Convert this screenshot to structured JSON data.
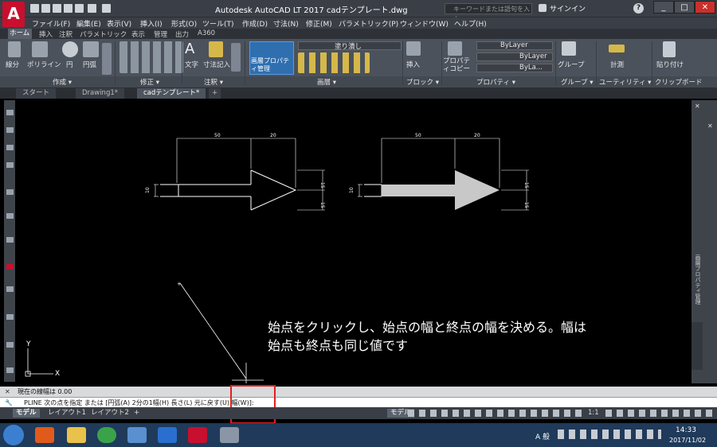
{
  "app": {
    "logo_letter": "A",
    "title": "Autodesk AutoCAD LT 2017    cadテンプレート.dwg",
    "search_placeholder": "キーワードまたは語句を入力",
    "signin": "サインイン",
    "window_buttons": [
      "_",
      "□",
      "✕"
    ]
  },
  "menu": [
    "ファイル(F)",
    "編集(E)",
    "表示(V)",
    "挿入(I)",
    "形式(O)",
    "ツール(T)",
    "作成(D)",
    "寸法(N)",
    "修正(M)",
    "パラメトリック(P)",
    "ウィンドウ(W)",
    "ヘルプ(H)"
  ],
  "ribbon_tabs": [
    "ホーム",
    "挿入",
    "注釈",
    "パラメトリック",
    "表示",
    "管理",
    "出力",
    "A360"
  ],
  "ribbon": {
    "draw": {
      "line": "線分",
      "polyline": "ポリライン",
      "circle": "円",
      "arc": "円弧",
      "panel": "作成 ▾"
    },
    "modify": {
      "panel": "修正 ▾"
    },
    "annotation": {
      "text": "文字",
      "dimension": "寸法記入",
      "panel": "注釈 ▾"
    },
    "layers": {
      "layer_props": "画層プロパティ管理",
      "layer_name": "塗り潰し",
      "panel": "画層 ▾"
    },
    "block": {
      "insert": "挿入",
      "panel": "ブロック ▾"
    },
    "properties": {
      "match": "プロパティコピー",
      "color": "ByLayer",
      "linetype": "ByLayer",
      "lineweight": "ByLa...",
      "panel": "プロパティ ▾"
    },
    "groups": {
      "group": "グループ",
      "panel": "グループ ▾"
    },
    "utilities": {
      "measure": "計測",
      "panel": "ユーティリティ ▾"
    },
    "clipboard": {
      "paste": "貼り付け",
      "panel": "クリップボード"
    }
  },
  "doc_tabs": [
    "スタート",
    "Drawing1*",
    "cadテンプレート*",
    "+"
  ],
  "drawing": {
    "dim_top_a": "50",
    "dim_top_b": "20",
    "dim_left": "10",
    "dim_right_a": "15",
    "dim_right_b": "15",
    "caption_line1": "始点をクリックし、始点の幅と終点の幅を決める。幅は",
    "caption_line2": "始点も終点も同じ値です"
  },
  "right_panel_label": "画層プロパティ管理",
  "command": {
    "history": "現在の線幅は 0.00",
    "prompt": "PLINE 次の点を指定 または [円弧(A) 2分の1幅(H) 長さ(L) 元に戻す(U) 幅(W)]:"
  },
  "status_tabs": [
    "モデル",
    "レイアウト1",
    "レイアウト2",
    "+"
  ],
  "status_right": {
    "model": "モデル",
    "scale": "1:1"
  },
  "taskbar": {
    "ime": "A 般",
    "time": "14:33",
    "date": "2017/11/02"
  },
  "colors": {
    "titlebar": "#3a3f47",
    "ribbon": "#4b525c",
    "canvas": "#000000",
    "highlight": "#e0201f",
    "taskbar": "#1f3a5a"
  }
}
